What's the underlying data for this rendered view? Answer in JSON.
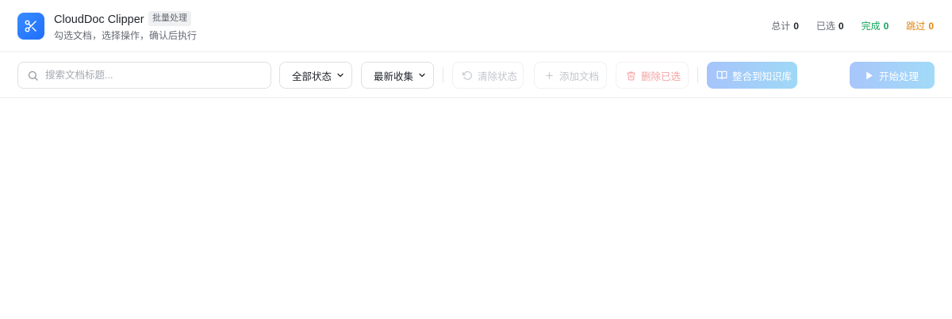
{
  "app": {
    "title": "CloudDoc Clipper",
    "badge": "批量处理",
    "subtitle": "勾选文档，选择操作，确认后执行",
    "icon": "scissors-icon",
    "accent": "#1e6fff"
  },
  "stats": {
    "total_label": "总计",
    "total_value": "0",
    "selected_label": "已选",
    "selected_value": "0",
    "done_label": "完成",
    "done_value": "0",
    "skip_label": "跳过",
    "skip_value": "0",
    "done_color": "#14a35a",
    "skip_color": "#e0820a"
  },
  "toolbar": {
    "search_placeholder": "搜索文档标题...",
    "status_filter": {
      "selected": "全部状态"
    },
    "sort": {
      "selected": "最新收集"
    },
    "clear_status_label": "清除状态",
    "add_doc_label": "添加文档",
    "delete_selected_label": "删除已选",
    "merge_kb_label": "整合到知识库",
    "start_label": "开始处理"
  }
}
